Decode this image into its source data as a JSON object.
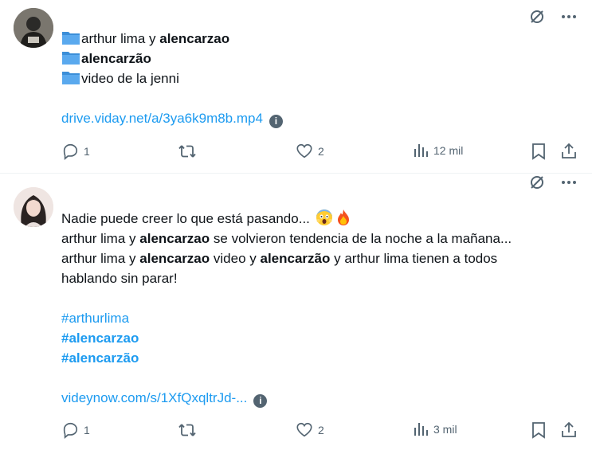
{
  "posts": [
    {
      "lines": [
        {
          "pre": "arthur lima y ",
          "bold": "alencarzao"
        },
        {
          "pre": "",
          "bold": "alencarzão"
        },
        {
          "pre": "video de la jenni",
          "bold": ""
        }
      ],
      "link": "drive.viday.net/a/3ya6k9m8b.mp4",
      "actions": {
        "replies": "1",
        "likes": "2",
        "views": "12 mil"
      },
      "icons": {
        "folder": "folder-icon",
        "info": "info-icon"
      }
    },
    {
      "text": [
        "Nadie puede creer lo que está pasando...",
        "arthur lima y",
        "alencarzao",
        "se volvieron tendencia de la noche a la mañana...",
        "arthur lima y",
        "alencarzao",
        "video y",
        "alencarzão",
        "y arthur lima tienen a todos",
        "hablando sin parar!"
      ],
      "hashtags": [
        "#arthurlima",
        "#alencarzao",
        "#alencarzão"
      ],
      "link": "videynow.com/s/1XfQxqltrJd-...",
      "actions": {
        "replies": "1",
        "likes": "2",
        "views": "3 mil"
      }
    }
  ],
  "colors": {
    "accent": "#1d9bf0",
    "muted": "#536471",
    "text": "#0f1419",
    "folder": "#3b8ed8"
  }
}
